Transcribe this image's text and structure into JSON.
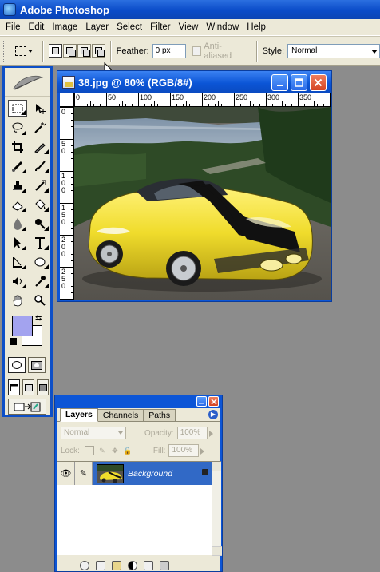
{
  "app": {
    "title": "Adobe Photoshop"
  },
  "menu": [
    "File",
    "Edit",
    "Image",
    "Layer",
    "Select",
    "Filter",
    "View",
    "Window",
    "Help"
  ],
  "options": {
    "feather_label": "Feather:",
    "feather_value": "0 px",
    "antialiased_label": "Anti-aliased",
    "style_label": "Style:",
    "style_value": "Normal"
  },
  "document": {
    "title": "38.jpg @ 80% (RGB/8#)",
    "ruler_top": [
      "0",
      "50",
      "100",
      "150",
      "200",
      "250",
      "300",
      "350"
    ],
    "ruler_left": [
      "0",
      "50",
      "100",
      "150",
      "200",
      "250"
    ]
  },
  "layers_palette": {
    "tabs": [
      "Layers",
      "Channels",
      "Paths"
    ],
    "blend_mode": "Normal",
    "opacity_label": "Opacity:",
    "opacity_value": "100%",
    "lock_label": "Lock:",
    "fill_label": "Fill:",
    "fill_value": "100%",
    "layer_name": "Background"
  },
  "colors": {
    "foreground": "#a3a3ef",
    "background": "#ffffff",
    "accent": "#0c55d6"
  }
}
